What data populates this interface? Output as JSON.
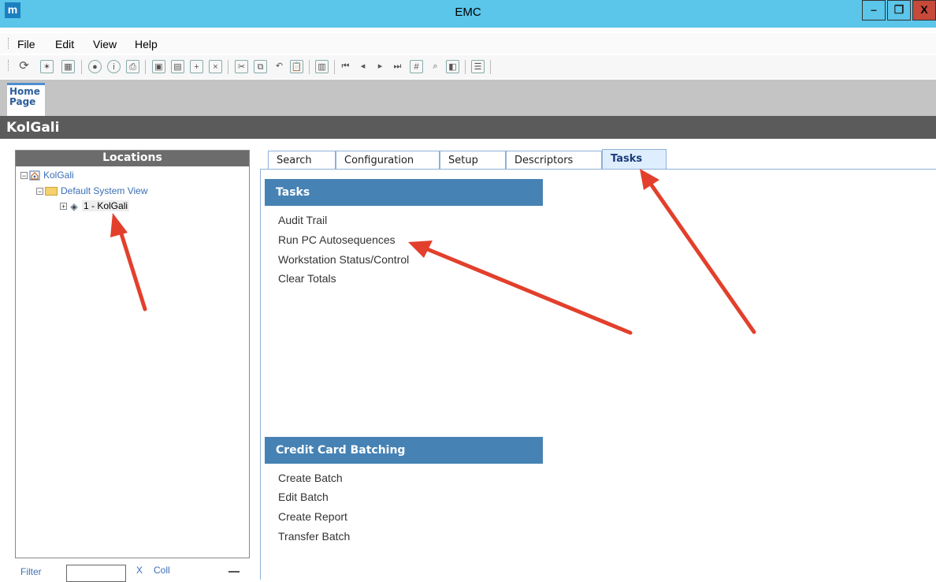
{
  "window": {
    "title": "EMC",
    "app_icon_letter": "m",
    "minimize_label": "–",
    "restore_label": "❐",
    "close_label": "X"
  },
  "menu": [
    "File",
    "Edit",
    "View",
    "Help"
  ],
  "home_tab": {
    "line1": "Home",
    "line2": "Page"
  },
  "location_title": "KolGali",
  "locations": {
    "header": "Locations",
    "tree": {
      "root": "KolGali",
      "view": "Default System View",
      "item": "1 - KolGali"
    },
    "filter_label": "Filter",
    "clear_label": "X",
    "collapse_label": "Coll"
  },
  "tabs": [
    "Search",
    "Configuration",
    "Setup",
    "Descriptors",
    "Tasks"
  ],
  "active_tab": "Tasks",
  "sections": [
    {
      "title": "Tasks",
      "items": [
        "Audit Trail",
        "Run PC Autosequences",
        "Workstation Status/Control",
        "Clear Totals"
      ]
    },
    {
      "title": "Credit Card Batching",
      "items": [
        "Create Batch",
        "Edit Batch",
        "Create Report",
        "Transfer Batch"
      ]
    }
  ],
  "colors": {
    "titlebar": "#5bc5ea",
    "section_header": "#4682b4",
    "annotation_arrow": "#e2402c"
  }
}
